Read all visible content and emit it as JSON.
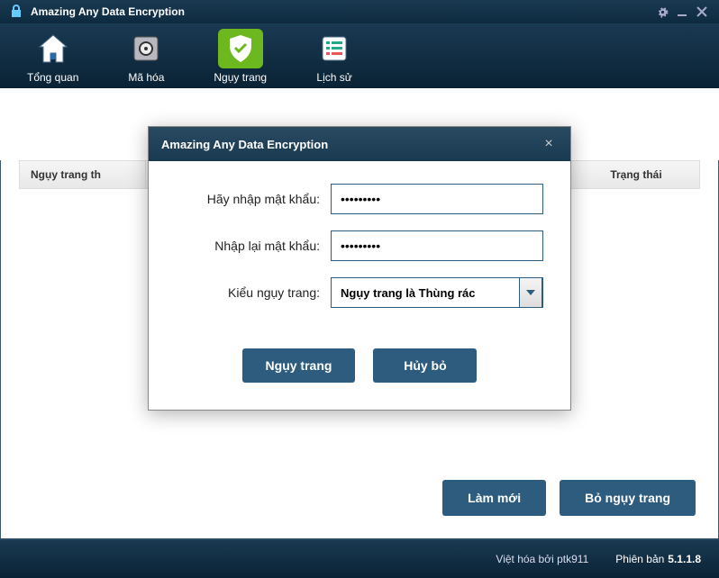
{
  "app": {
    "title": "Amazing Any Data Encryption"
  },
  "toolbar": {
    "items": [
      {
        "label": "Tổng quan"
      },
      {
        "label": "Mã hóa"
      },
      {
        "label": "Ngụy trang"
      },
      {
        "label": "Lịch sử"
      }
    ]
  },
  "table": {
    "col_path": "Ngụy trang th",
    "col_status": "Trạng thái"
  },
  "buttons": {
    "refresh": "Làm mới",
    "un_disguise": "Bỏ ngụy trang"
  },
  "footer": {
    "credit": "Việt hóa bởi ptk911",
    "version_label": "Phiên bản",
    "version": "5.1.1.8"
  },
  "modal": {
    "title": "Amazing Any Data Encryption",
    "label_password": "Hãy nhập mật khẩu:",
    "label_confirm": "Nhập lại mật khẩu:",
    "label_type": "Kiểu ngụy trang:",
    "password_value": "*********",
    "confirm_value": "*********",
    "type_selected": "Ngụy trang là Thùng rác",
    "btn_disguise": "Ngụy trang",
    "btn_cancel": "Hủy bỏ"
  }
}
